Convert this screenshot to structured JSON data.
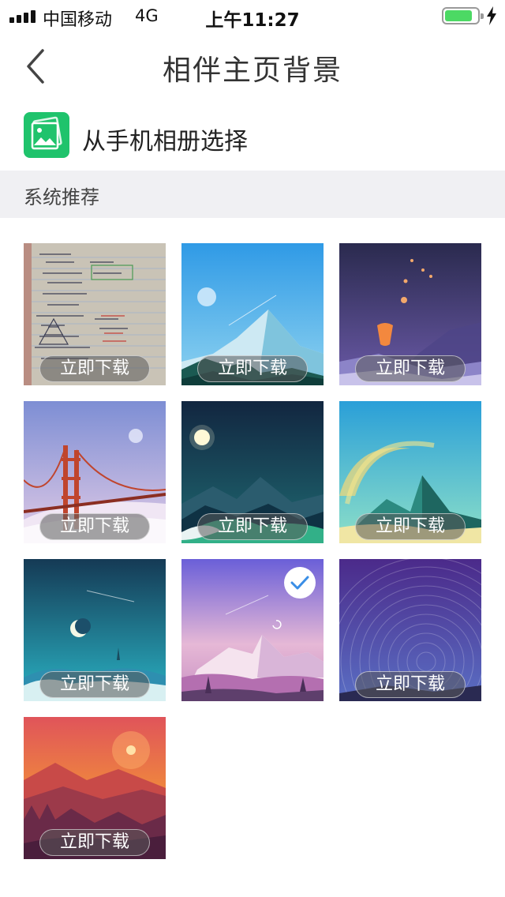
{
  "status_bar": {
    "carrier": "中国移动",
    "network": "4G",
    "time": "上午11:27",
    "battery_level": 0.85
  },
  "nav": {
    "title": "相伴主页背景",
    "back_icon": "chevron-left-icon"
  },
  "album": {
    "label": "从手机相册选择",
    "icon": "photo-album-icon",
    "icon_color": "#1fc36c"
  },
  "section": {
    "label": "系统推荐"
  },
  "wallpapers": [
    {
      "name": "notebook-notes",
      "button": "立即下载",
      "selected": false
    },
    {
      "name": "blue-mountain",
      "button": "立即下载",
      "selected": false
    },
    {
      "name": "sky-lanterns",
      "button": "立即下载",
      "selected": false
    },
    {
      "name": "golden-gate-bridge",
      "button": "立即下载",
      "selected": false
    },
    {
      "name": "night-moon-mountains",
      "button": "立即下载",
      "selected": false
    },
    {
      "name": "ringed-planet-mountain",
      "button": "立即下载",
      "selected": false
    },
    {
      "name": "crescent-moon-sea",
      "button": "立即下载",
      "selected": false
    },
    {
      "name": "purple-snow-mountains",
      "button": "",
      "selected": true
    },
    {
      "name": "star-trails",
      "button": "立即下载",
      "selected": false
    },
    {
      "name": "orange-sunset-forest",
      "button": "立即下载",
      "selected": false
    }
  ],
  "colors": {
    "accent_green": "#1fc36c",
    "section_bg": "#f0f0f3",
    "check_blue": "#3a8ee6"
  }
}
